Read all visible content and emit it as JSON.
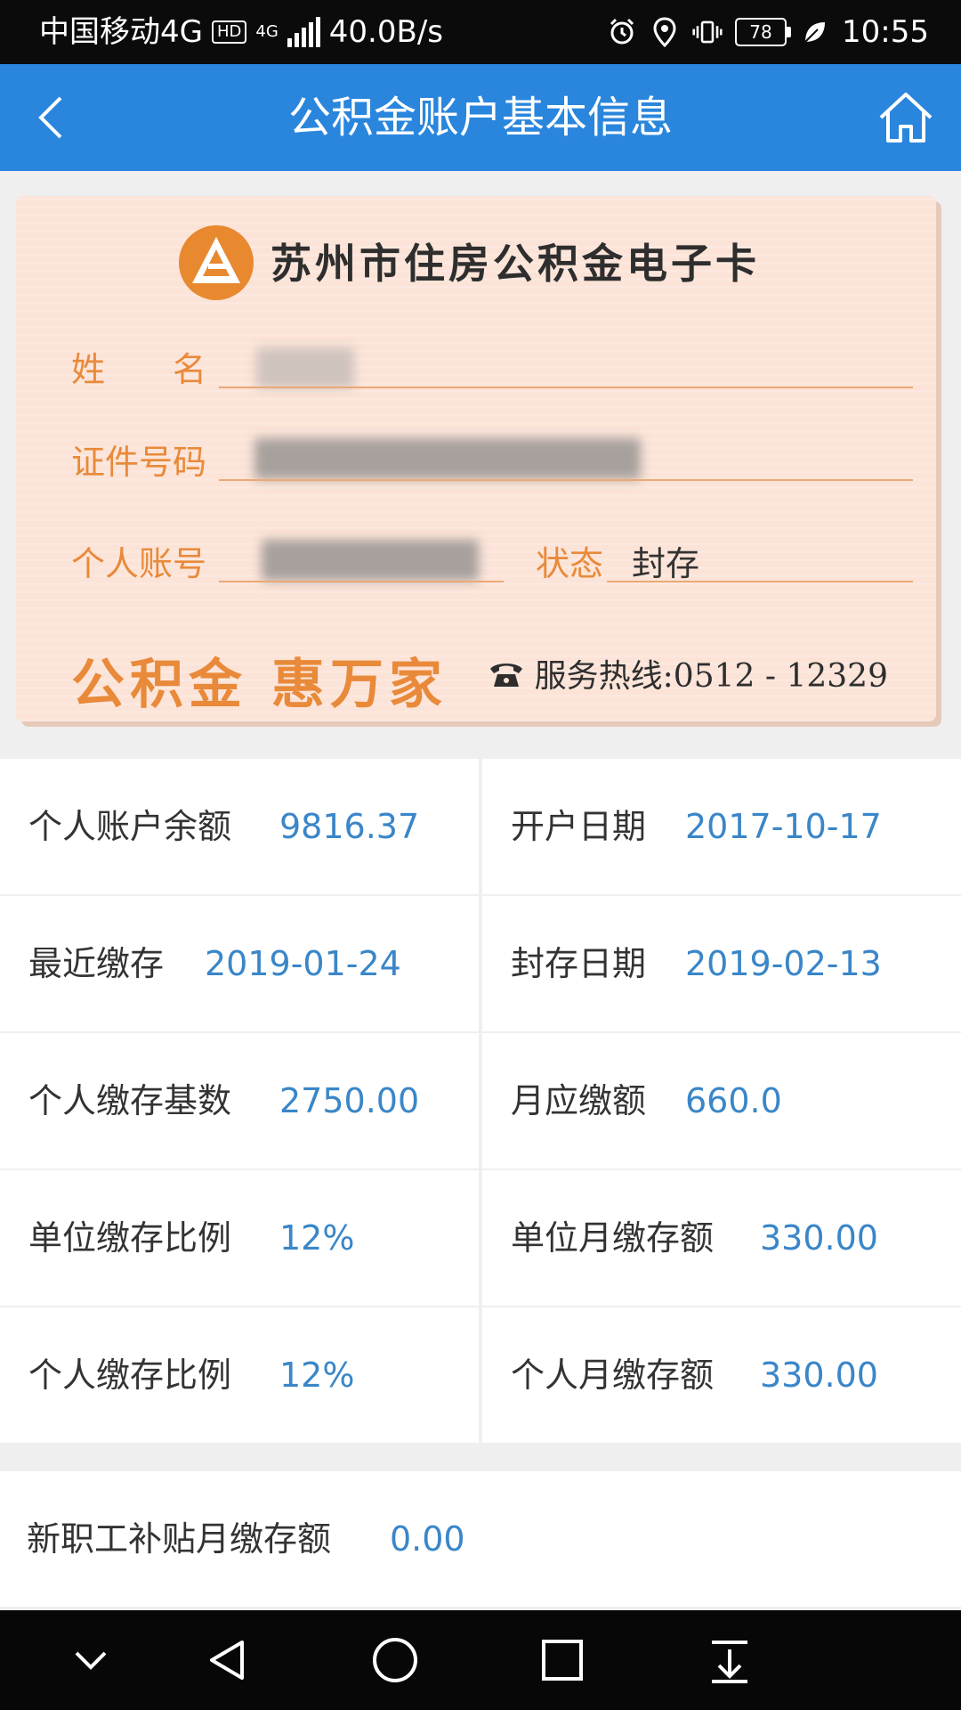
{
  "status_bar": {
    "carrier": "中国移动4G",
    "hd_badge": "HD",
    "network_small": "4G",
    "speed": "40.0B/s",
    "battery": "78",
    "time": "10:55"
  },
  "header": {
    "title": "公积金账户基本信息"
  },
  "card": {
    "title": "苏州市住房公积金电子卡",
    "name_label": "姓　　名",
    "id_label": "证件号码",
    "account_label": "个人账号",
    "status_label": "状态",
    "status_value": "封存",
    "slogan": "公积金 惠万家",
    "hotline": "服务热线:0512 - 12329"
  },
  "info": [
    {
      "label": "个人账户余额",
      "value": "9816.37"
    },
    {
      "label": "开户日期",
      "value": "2017-10-17"
    },
    {
      "label": "最近缴存",
      "value": "2019-01-24"
    },
    {
      "label": "封存日期",
      "value": "2019-02-13"
    },
    {
      "label": "个人缴存基数",
      "value": "2750.00"
    },
    {
      "label": "月应缴额",
      "value": "660.0"
    },
    {
      "label": "单位缴存比例",
      "value": "12%"
    },
    {
      "label": "单位月缴存额",
      "value": "330.00"
    },
    {
      "label": "个人缴存比例",
      "value": "12%"
    },
    {
      "label": "个人月缴存额",
      "value": "330.00"
    }
  ],
  "extra": {
    "label": "新职工补贴月缴存额",
    "value": "0.00"
  },
  "colors": {
    "header_blue": "#2a86dd",
    "value_blue": "#3a86c8",
    "card_orange": "#e88a3a",
    "card_bg": "#fce3d7"
  },
  "icons": {
    "back": "chevron-left-icon",
    "home": "home-icon",
    "phone": "phone-icon"
  }
}
